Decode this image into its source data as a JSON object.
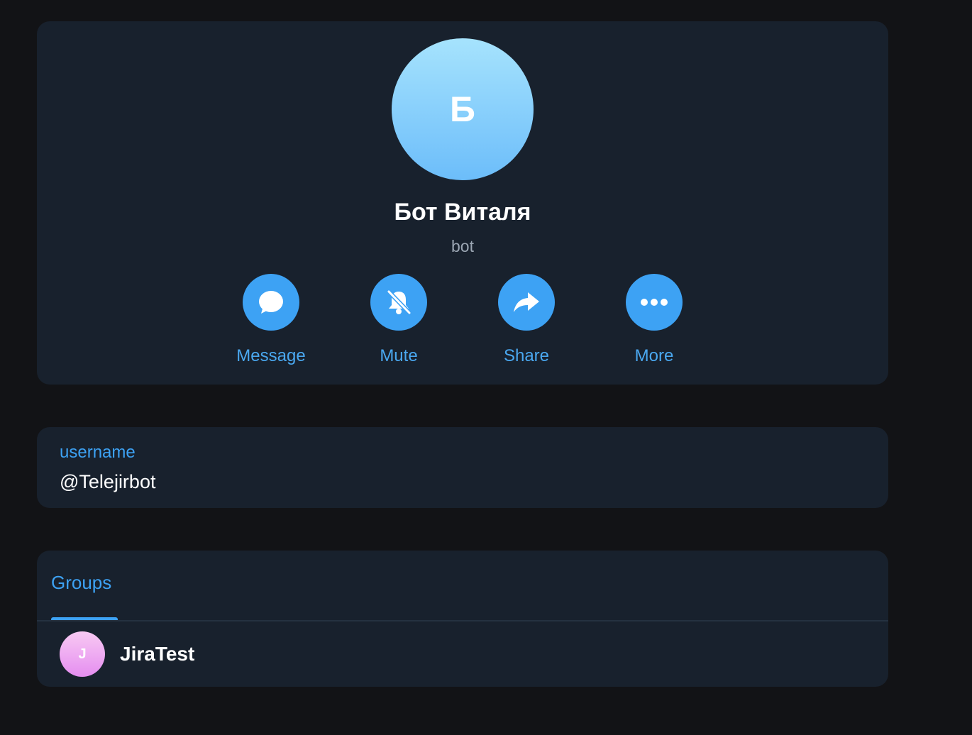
{
  "profile": {
    "avatar_letter": "Б",
    "name": "Бот Виталя",
    "subtitle": "bot",
    "accent_color": "#3da2f4",
    "actions": [
      {
        "label": "Message",
        "icon": "chat-bubble-icon"
      },
      {
        "label": "Mute",
        "icon": "bell-off-icon"
      },
      {
        "label": "Share",
        "icon": "share-arrow-icon"
      },
      {
        "label": "More",
        "icon": "more-dots-icon"
      }
    ]
  },
  "info": {
    "username_label": "username",
    "username_value": "@Telejirbot"
  },
  "groups": {
    "tab_label": "Groups",
    "items": [
      {
        "avatar_letter": "J",
        "name": "JiraTest"
      }
    ]
  }
}
